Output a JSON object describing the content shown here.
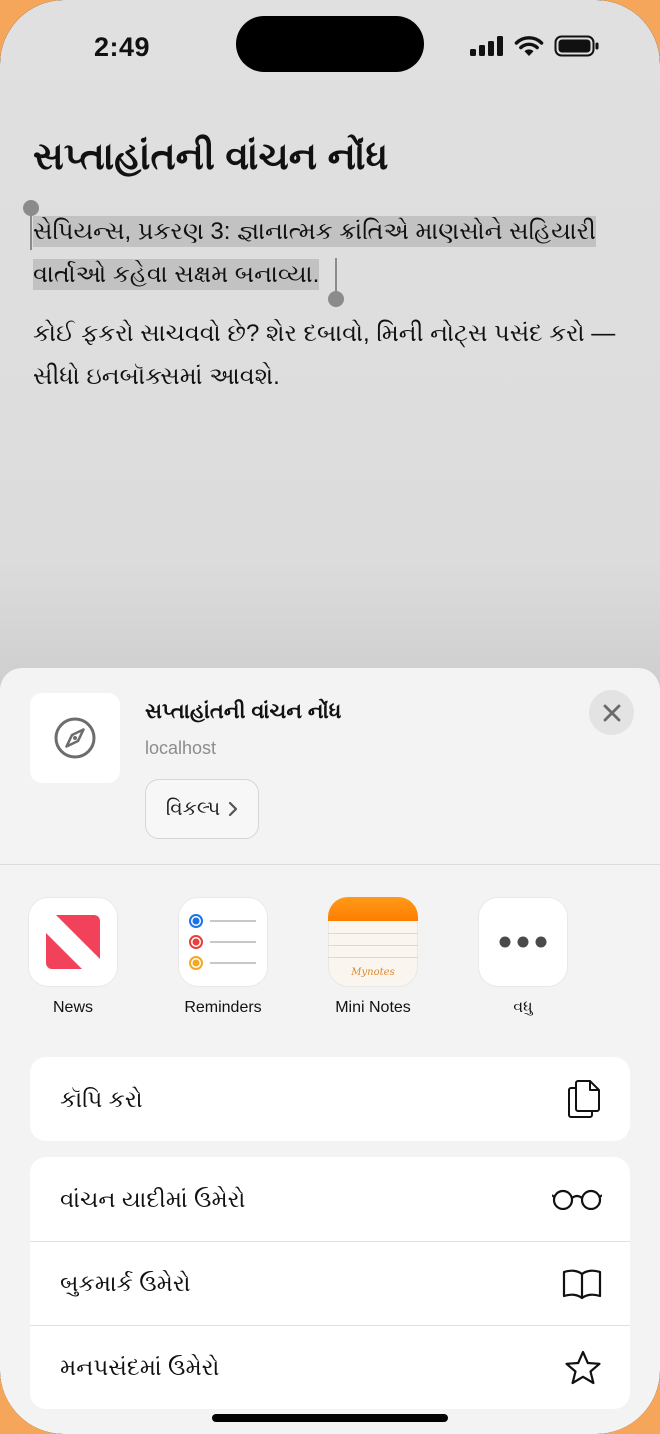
{
  "status": {
    "time": "2:49"
  },
  "page": {
    "title": "સપ્તાહાંતની વાંચન નોંધ",
    "selected_text": "સેપિયન્સ, પ્રકરણ 3: જ્ઞાનાત્મક ક્રાંતિએ માણસોને સહિયારી વાર્તાઓ કહેવા સક્ષમ બનાવ્યા.",
    "instructions": "કોઈ ફકરો સાચવવો છે? શેર દબાવો, મિની નોટ્સ પસંદ કરો — સીધો ઇનબૉક્સમાં આવશે."
  },
  "sheet": {
    "title": "સપ્તાહાંતની વાંચન નોંધ",
    "subtitle": "localhost",
    "options_label": "વિકલ્પ",
    "apps": [
      {
        "label": "News",
        "icon": "news-icon"
      },
      {
        "label": "Reminders",
        "icon": "reminders-icon"
      },
      {
        "label": "Mini Notes",
        "icon": "mini-notes-icon",
        "brand": "Mynotes"
      },
      {
        "label": "વધુ",
        "icon": "more-icon"
      }
    ],
    "actions": [
      {
        "label": "કૉપિ કરો",
        "icon": "copy-icon"
      },
      {
        "label": "વાંચન યાદીમાં ઉમેરો",
        "icon": "glasses-icon"
      },
      {
        "label": "બુકમાર્ક ઉમેરો",
        "icon": "book-icon"
      },
      {
        "label": "મનપસંદમાં ઉમેરો",
        "icon": "star-icon"
      }
    ]
  },
  "colors": {
    "news": "#f2425b",
    "notes_orange": "#ff8a00",
    "accent_bg": "#f5a65b"
  }
}
